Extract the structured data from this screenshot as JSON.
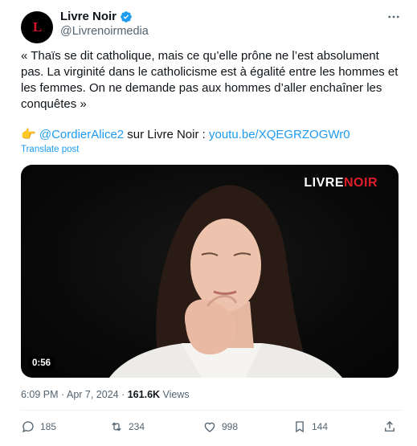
{
  "author": {
    "display_name": "Livre Noir",
    "handle": "@Livrenoirmedia",
    "avatar_text": "L"
  },
  "tweet": {
    "text": "« Thaïs se dit catholique, mais ce qu’elle prône ne l’est absolument pas. La virginité dans le catholicisme est à égalité entre les hommes et les femmes. On ne demande pas aux hommes d’aller enchaîner les conquêtes »",
    "pointer_emoji": "👉",
    "mention": "@CordierAlice2",
    "link_prefix": " sur Livre Noir : ",
    "link": "youtu.be/XQEGRZOGWr0",
    "translate_label": "Translate post"
  },
  "media": {
    "watermark_part1": "LIVRE",
    "watermark_part2": "NOIR",
    "duration": "0:56"
  },
  "meta": {
    "time": "6:09 PM",
    "separator": " · ",
    "date": "Apr 7, 2024",
    "views_count": "161.6K",
    "views_label": "Views"
  },
  "actions": {
    "replies": "185",
    "reposts": "234",
    "likes": "998",
    "bookmarks": "144"
  },
  "colors": {
    "accent": "#1d9bf0",
    "brand_red": "#e11d2a",
    "secondary_text": "#536471"
  }
}
